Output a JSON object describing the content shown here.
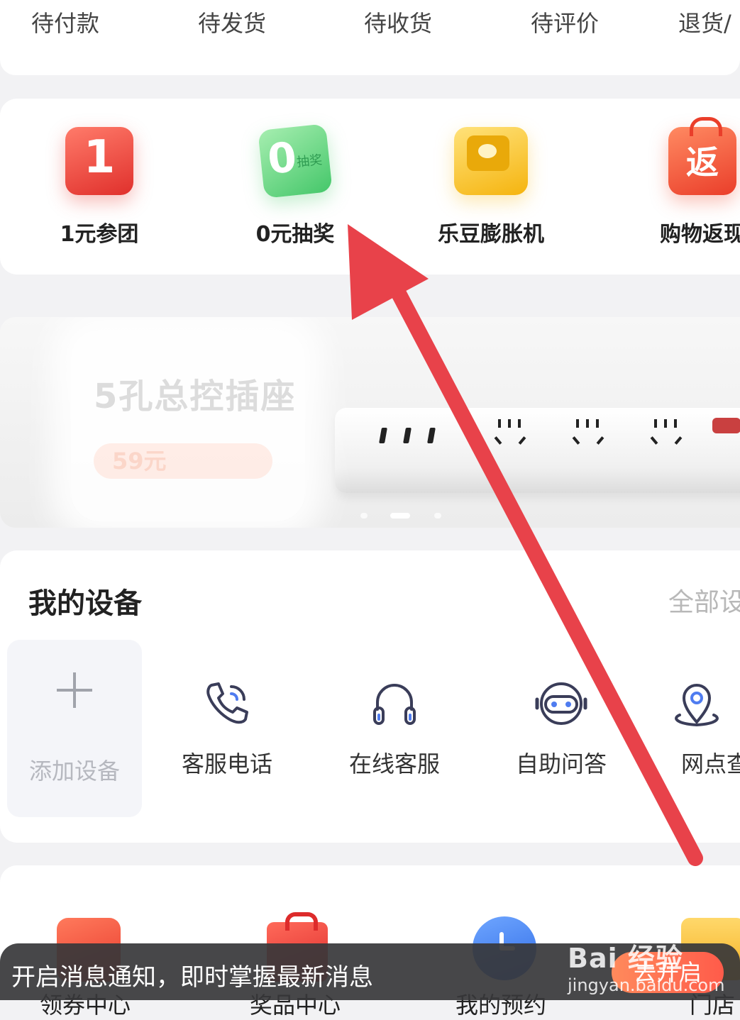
{
  "order_tabs": [
    "待付款",
    "待发货",
    "待收货",
    "待评价",
    "退货/"
  ],
  "promos": [
    {
      "label": "1元参团",
      "icon": "one-yuan-group-icon",
      "glyph": "1",
      "color": "#e8453c"
    },
    {
      "label": "0元抽奖",
      "icon": "zero-yuan-lottery-icon",
      "glyph": "0",
      "badge": "抽奖",
      "color": "#5fd17a"
    },
    {
      "label": "乐豆膨胀机",
      "icon": "ledou-machine-icon",
      "color": "#f9c12c"
    },
    {
      "label": "购物返现",
      "icon": "shopping-cashback-icon",
      "glyph": "返",
      "color": "#f0553c"
    }
  ],
  "banner": {
    "title": "5孔总控插座",
    "price": "59元"
  },
  "devices": {
    "title": "我的设备",
    "all_link": "全部设",
    "add_label": "添加设备",
    "services": [
      {
        "label": "客服电话",
        "icon": "phone-icon"
      },
      {
        "label": "在线客服",
        "icon": "headset-icon"
      },
      {
        "label": "自助问答",
        "icon": "robot-icon"
      },
      {
        "label": "网点查",
        "icon": "location-pin-icon"
      }
    ]
  },
  "bottom_row": [
    "领券中心",
    "奖品中心",
    "我的预约",
    "门店"
  ],
  "notification": {
    "text": "开启消息通知，即时掌握最新消息",
    "button": "去开启"
  },
  "watermark": {
    "brand": "Bai 经验",
    "url": "jingyan.baidu.com"
  },
  "colors": {
    "accent": "#e8424a",
    "notify_button": "#ff6a4e"
  }
}
